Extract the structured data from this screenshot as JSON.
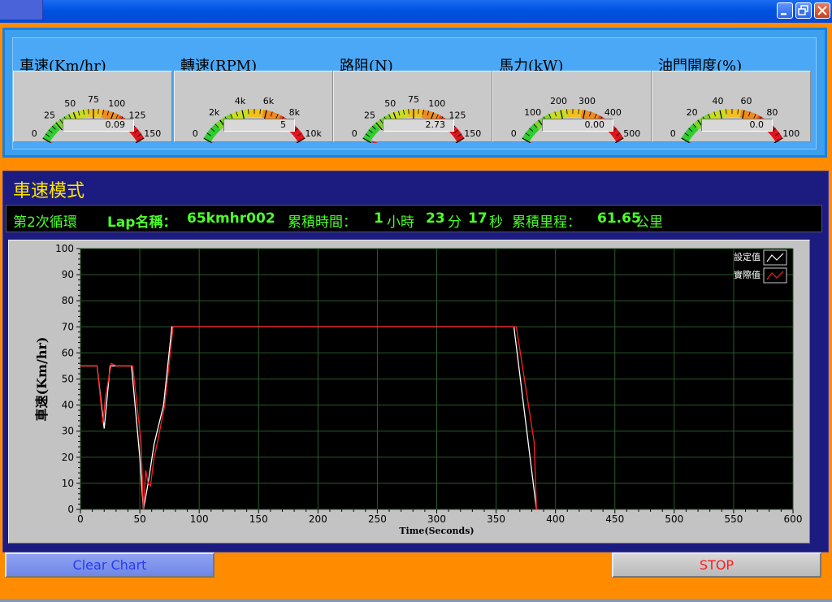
{
  "window": {
    "title": "",
    "buttons": [
      "minimize-icon",
      "restore-icon",
      "close-icon"
    ],
    "colors": {
      "titlebar": "#0052e0",
      "background": "#ff8c00",
      "panel": "#3da0ee",
      "main_panel": "#1c1c80"
    }
  },
  "gauges": [
    {
      "label": "車速(Km/hr)",
      "ticks": [
        "0",
        "25",
        "50",
        "75",
        "100",
        "125",
        "150"
      ],
      "min": 0,
      "max": 150,
      "value": 0.09,
      "display": "0.09"
    },
    {
      "label": "轉速(RPM)",
      "ticks": [
        "0",
        "2k",
        "4k",
        "6k",
        "8k",
        "10k"
      ],
      "min": 0,
      "max": 10000,
      "value": 5,
      "display": "5"
    },
    {
      "label": "路阻(N)",
      "ticks": [
        "0",
        "25",
        "50",
        "75",
        "100",
        "125",
        "150"
      ],
      "min": 0,
      "max": 150,
      "value": 2.73,
      "display": "2.73"
    },
    {
      "label": "馬力(kW)",
      "ticks": [
        "0",
        "100",
        "200",
        "300",
        "400",
        "500"
      ],
      "min": 0,
      "max": 500,
      "value": 0.0,
      "display": "0.00"
    },
    {
      "label": "油門開度(%)",
      "ticks": [
        "0",
        "20",
        "40",
        "60",
        "80",
        "100"
      ],
      "min": 0,
      "max": 100,
      "value": 0.0,
      "display": "0.0"
    }
  ],
  "mode": {
    "title": "車速模式"
  },
  "status": {
    "cycle": "第2次循環",
    "lap_label": "Lap名稱：",
    "lap_name": "65kmhr002",
    "time_label": "累積時間：",
    "hours": "1",
    "hours_unit": "小時",
    "minutes": "23",
    "minutes_unit": "分",
    "seconds": "17",
    "seconds_unit": "秒",
    "distance_label": "累積里程：",
    "distance": "61.65",
    "distance_unit": "公里"
  },
  "chart_data": {
    "type": "line",
    "title": "",
    "xlabel": "Time(Seconds)",
    "ylabel": "車速(Km/hr)",
    "xlim": [
      0,
      600
    ],
    "ylim": [
      0,
      100
    ],
    "xticks": [
      0,
      50,
      100,
      150,
      200,
      250,
      300,
      350,
      400,
      450,
      500,
      550,
      600
    ],
    "yticks": [
      0,
      10,
      20,
      30,
      40,
      50,
      60,
      70,
      80,
      90,
      100
    ],
    "grid": true,
    "legend_position": "top-right",
    "series": [
      {
        "name": "設定值",
        "color": "#ffffff",
        "x": [
          0,
          14,
          20,
          25,
          43,
          50,
          53,
          57,
          62,
          70,
          77,
          365,
          384,
          385
        ],
        "y": [
          55,
          55,
          31,
          55,
          55,
          20,
          0,
          10,
          25,
          40,
          70,
          70,
          0,
          0
        ]
      },
      {
        "name": "實際值",
        "color": "#ff2020",
        "x": [
          0,
          14,
          19,
          21,
          26,
          30,
          44,
          51,
          53,
          55,
          57,
          59,
          62,
          65,
          71,
          78,
          367,
          382,
          384,
          386
        ],
        "y": [
          55,
          55,
          33,
          43,
          56,
          55,
          55,
          26,
          0,
          15,
          10,
          9,
          20,
          26,
          40,
          70,
          70,
          26,
          0,
          0
        ]
      }
    ]
  },
  "buttons": {
    "clear": "Clear Chart",
    "stop": "STOP"
  }
}
